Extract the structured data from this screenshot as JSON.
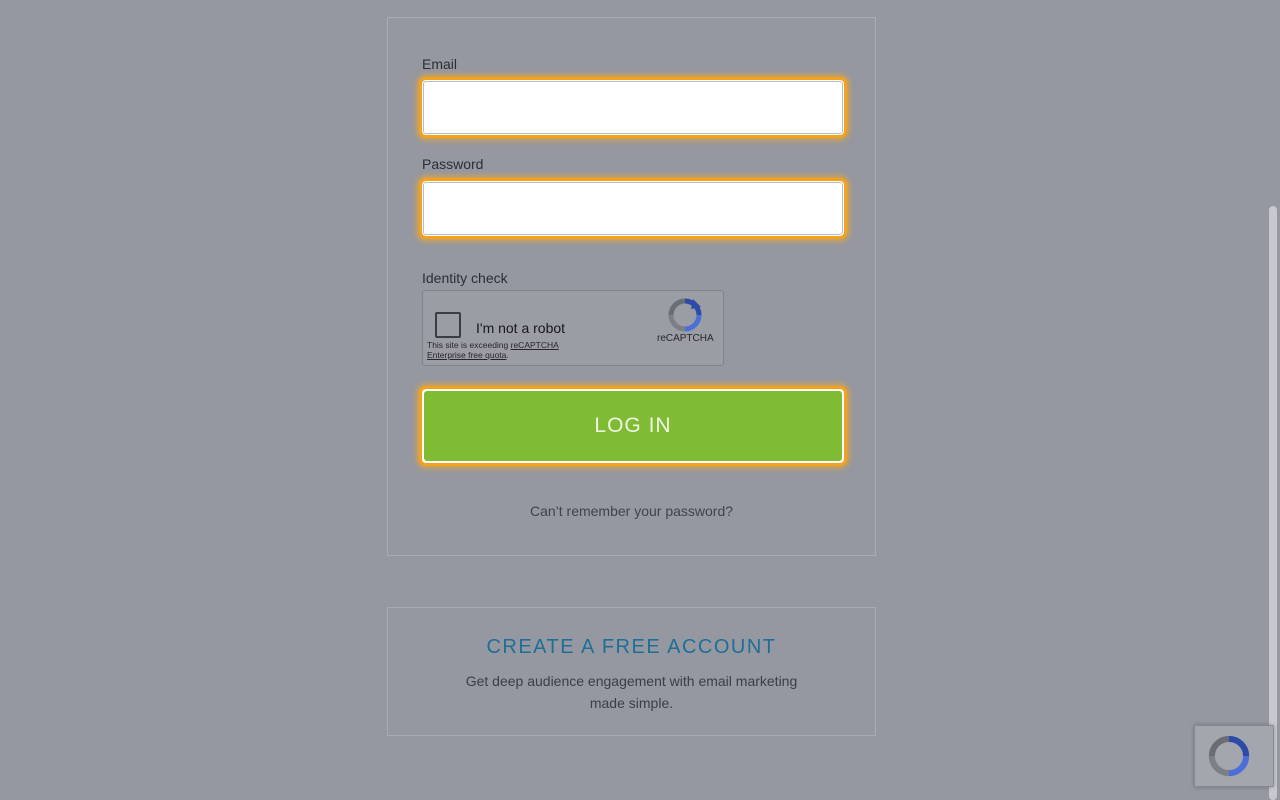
{
  "login_form": {
    "email_label": "Email",
    "email_value": "",
    "password_label": "Password",
    "password_value": "",
    "identity_label": "Identity check",
    "recaptcha": {
      "checkbox_label": "I'm not a robot",
      "brand": "reCAPTCHA",
      "quota_prefix": "This site is exceeding ",
      "quota_link_1": "reCAPTCHA",
      "quota_link_2": "Enterprise free quota",
      "quota_suffix": "."
    },
    "login_button": "LOG IN",
    "forgot_link": "Can’t remember your password?"
  },
  "signup": {
    "title": "CREATE A FREE ACCOUNT",
    "description": "Get deep audience engagement with email marketing made simple."
  },
  "icons": {
    "recaptcha_logo": "recaptcha-logo-icon",
    "recaptcha_badge": "recaptcha-badge-icon"
  },
  "colors": {
    "focus_ring": "#f3a21e",
    "login_button": "#80bb34",
    "signup_title": "#1f6e98",
    "overlay_bg": "#9598a0"
  }
}
